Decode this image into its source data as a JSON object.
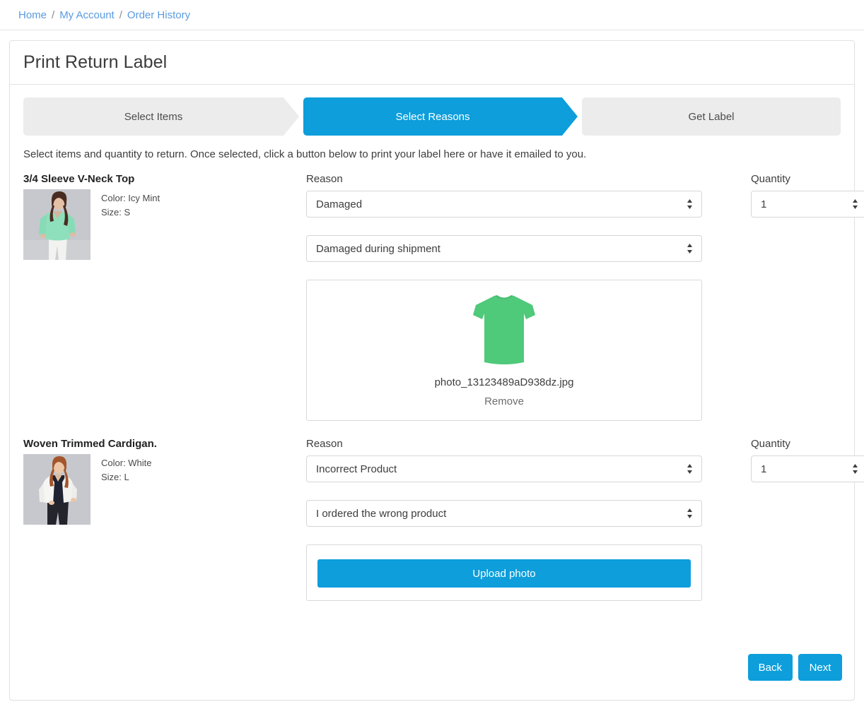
{
  "breadcrumb": {
    "items": [
      {
        "label": "Home"
      },
      {
        "label": "My Account"
      },
      {
        "label": "Order History"
      }
    ],
    "separator": "/"
  },
  "card": {
    "title": "Print Return Label"
  },
  "wizard": {
    "steps": [
      {
        "label": "Select Items",
        "state": "completed"
      },
      {
        "label": "Select Reasons",
        "state": "active"
      },
      {
        "label": "Get Label",
        "state": "upcoming"
      }
    ]
  },
  "instructions": "Select items and quantity to return. Once selected, click a button below to print your label here or have it emailed to you.",
  "labels": {
    "reason": "Reason",
    "quantity": "Quantity",
    "remove": "Remove",
    "upload_photo": "Upload photo"
  },
  "items": [
    {
      "name": "3/4 Sleeve V-Neck Top",
      "color_line": "Color: Icy Mint",
      "size_line": "Size: S",
      "reason_label": "Reason",
      "reason_value": "Damaged",
      "detail_value": "Damaged during shipment",
      "quantity_label": "Quantity",
      "quantity_value": "1",
      "photo": {
        "filename": "photo_13123489aD938dz.jpg",
        "remove_label": "Remove"
      }
    },
    {
      "name": "Woven Trimmed Cardigan.",
      "color_line": "Color: White",
      "size_line": "Size: L",
      "reason_label": "Reason",
      "reason_value": "Incorrect Product",
      "detail_value": "I ordered the wrong product",
      "quantity_label": "Quantity",
      "quantity_value": "1",
      "upload_label": "Upload photo"
    }
  ],
  "footer": {
    "back_label": "Back",
    "next_label": "Next"
  },
  "colors": {
    "accent": "#0d9edb",
    "link": "#5a9ae0",
    "step_inactive_bg": "#ececec",
    "text": "#3d3d3d",
    "border": "#d6d6d6",
    "mint": "#7fdbb0",
    "tshirt_green": "#4fc97a"
  }
}
